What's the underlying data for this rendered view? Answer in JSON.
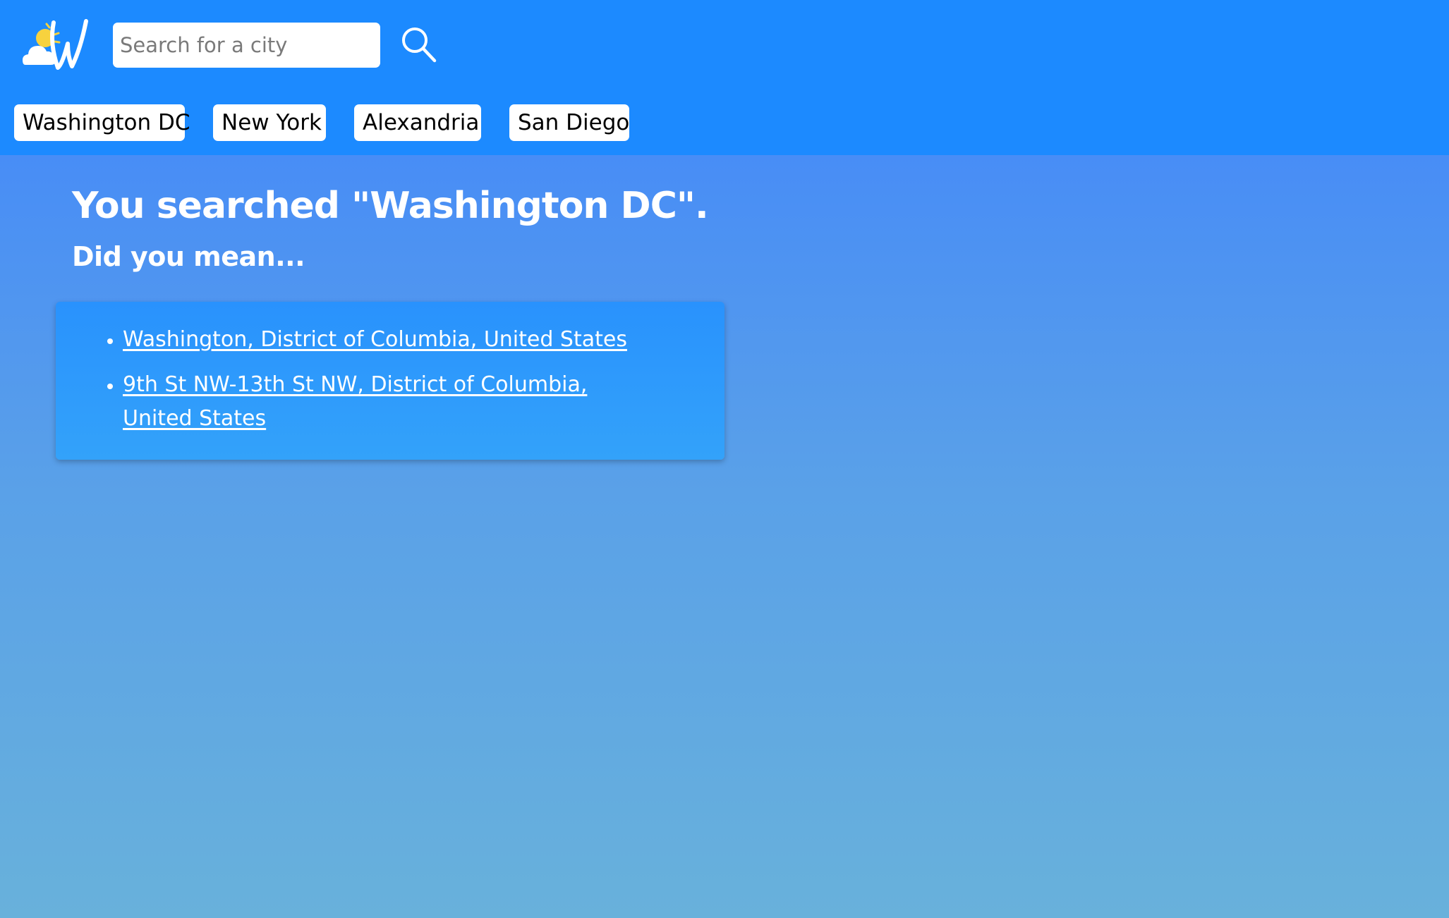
{
  "search": {
    "placeholder": "Search for a city",
    "value": ""
  },
  "quick_cities": [
    "Washington DC",
    "New York",
    "Alexandria",
    "San Diego"
  ],
  "results": {
    "heading": "You searched \"Washington DC\".",
    "subheading": "Did you mean...",
    "suggestions": [
      "Washington, District of Columbia, United States",
      "9th St NW-13th St NW, District of Columbia, United States"
    ]
  },
  "icons": {
    "logo": "weather-logo-icon",
    "search": "search-icon"
  },
  "colors": {
    "header_bg": "#1c8aff",
    "page_gradient_top": "#488df6",
    "page_gradient_bottom": "#68b1db",
    "card_bg": "#2992fd",
    "sun": "#f7d23e",
    "text_light": "#ffffff"
  }
}
